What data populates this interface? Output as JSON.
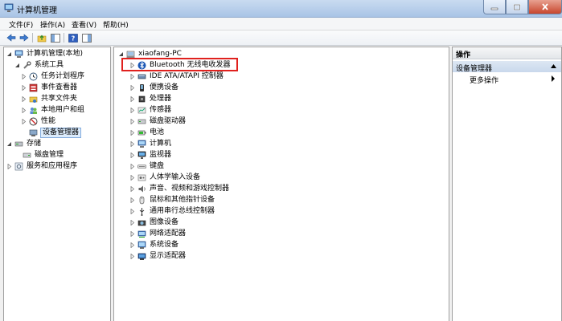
{
  "window": {
    "title": "计算机管理"
  },
  "menu": [
    "文件(F)",
    "操作(A)",
    "查看(V)",
    "帮助(H)"
  ],
  "left_tree": [
    {
      "label": "计算机管理(本地)",
      "level": 0,
      "expander": "open",
      "icon": "computer-icon"
    },
    {
      "label": "系统工具",
      "level": 1,
      "expander": "open",
      "icon": "tools-icon"
    },
    {
      "label": "任务计划程序",
      "level": 2,
      "expander": "closed",
      "icon": "clock-icon"
    },
    {
      "label": "事件查看器",
      "level": 2,
      "expander": "closed",
      "icon": "event-viewer-icon"
    },
    {
      "label": "共享文件夹",
      "level": 2,
      "expander": "closed",
      "icon": "shared-folder-icon"
    },
    {
      "label": "本地用户和组",
      "level": 2,
      "expander": "closed",
      "icon": "users-icon"
    },
    {
      "label": "性能",
      "level": 2,
      "expander": "closed",
      "icon": "performance-icon"
    },
    {
      "label": "设备管理器",
      "level": 2,
      "expander": "none",
      "icon": "device-manager-icon",
      "selected": true
    },
    {
      "label": "存储",
      "level": 0,
      "expander": "open",
      "icon": "storage-icon"
    },
    {
      "label": "磁盘管理",
      "level": 1,
      "expander": "none",
      "icon": "disk-icon"
    },
    {
      "label": "服务和应用程序",
      "level": 0,
      "expander": "closed",
      "icon": "services-icon"
    }
  ],
  "device_tree": {
    "root": "xiaofang-PC",
    "items": [
      {
        "label": "Bluetooth 无线电收发器",
        "icon": "bluetooth-icon"
      },
      {
        "label": "IDE ATA/ATAPI 控制器",
        "icon": "ide-controller-icon"
      },
      {
        "label": "便携设备",
        "icon": "portable-device-icon"
      },
      {
        "label": "处理器",
        "icon": "processor-icon"
      },
      {
        "label": "传感器",
        "icon": "sensor-icon"
      },
      {
        "label": "磁盘驱动器",
        "icon": "disk-drive-icon"
      },
      {
        "label": "电池",
        "icon": "battery-icon"
      },
      {
        "label": "计算机",
        "icon": "computer-icon"
      },
      {
        "label": "监视器",
        "icon": "monitor-icon"
      },
      {
        "label": "键盘",
        "icon": "keyboard-icon"
      },
      {
        "label": "人体学输入设备",
        "icon": "hid-icon"
      },
      {
        "label": "声音、视频和游戏控制器",
        "icon": "sound-icon"
      },
      {
        "label": "鼠标和其他指针设备",
        "icon": "mouse-icon"
      },
      {
        "label": "通用串行总线控制器",
        "icon": "usb-icon"
      },
      {
        "label": "图像设备",
        "icon": "imaging-icon"
      },
      {
        "label": "网络适配器",
        "icon": "network-adapter-icon"
      },
      {
        "label": "系统设备",
        "icon": "system-device-icon"
      },
      {
        "label": "显示适配器",
        "icon": "display-adapter-icon"
      }
    ]
  },
  "actions": {
    "header": "操作",
    "group": "设备管理器",
    "more": "更多操作"
  },
  "colors": {
    "highlight": "#e0211e",
    "selection": "#dcecfc"
  }
}
